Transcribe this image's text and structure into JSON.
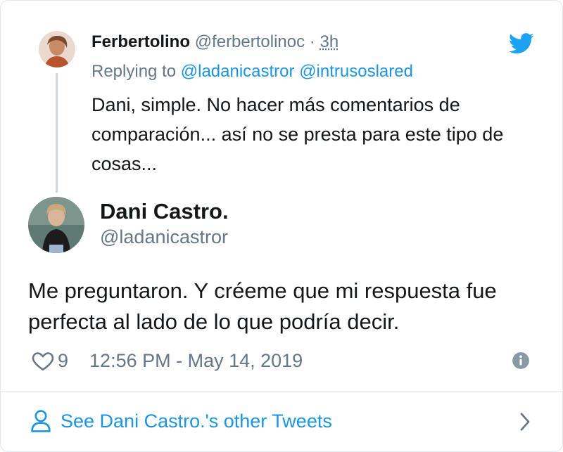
{
  "reply": {
    "name": "Ferbertolino",
    "handle": "@ferbertolinoc",
    "separator": "·",
    "time": "3h",
    "replying_prefix": "Replying to",
    "mention_1": "@ladanicastror",
    "mention_2": "@intrusoslared",
    "text": "Dani, simple. No hacer más comentarios de comparación... así no se presta para este tipo de cosas..."
  },
  "tweet": {
    "name": "Dani Castro.",
    "handle": "@ladanicastror",
    "text": "Me preguntaron. Y créeme que mi respuesta fue perfecta al lado de lo que podría decir.",
    "likes": "9",
    "timestamp": "12:56 PM - May 14, 2019"
  },
  "footer": {
    "link_text": "See Dani Castro.'s other Tweets"
  },
  "icons": {
    "brand": "twitter-bird-icon",
    "like": "heart-icon",
    "info": "info-icon",
    "profile": "person-icon",
    "next": "chevron-right-icon"
  },
  "colors": {
    "accent": "#1b95e0",
    "brand": "#1da1f2",
    "secondary_text": "#657786",
    "primary_text": "#14171a",
    "divider": "#e1e8ed"
  }
}
